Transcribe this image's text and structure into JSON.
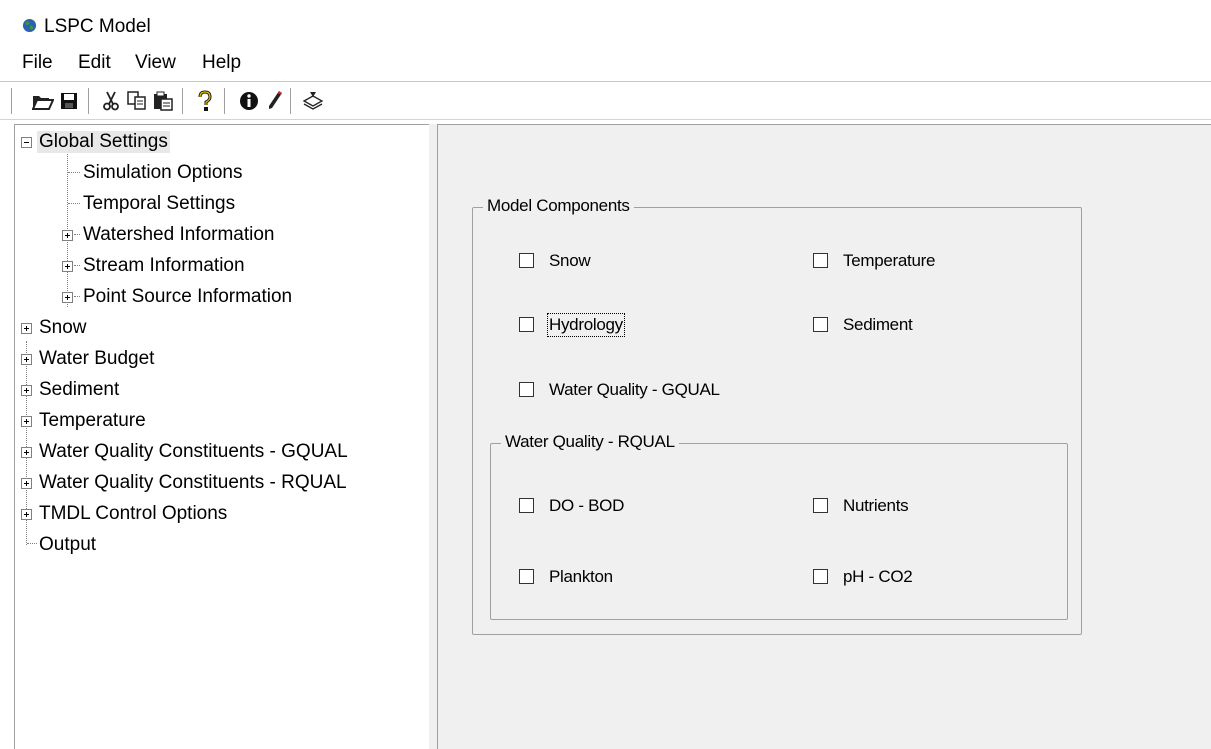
{
  "window": {
    "title": "LSPC Model"
  },
  "menu": [
    "File",
    "Edit",
    "View",
    "Help"
  ],
  "toolbar": {
    "buttons": [
      "open-icon",
      "save-icon",
      "cut-icon",
      "copy-icon",
      "paste-icon",
      "help-icon",
      "info-icon",
      "edit-pencil-icon",
      "run-model-icon"
    ]
  },
  "tree": {
    "items": [
      {
        "label": "Global Settings",
        "expanded": true,
        "selected": true
      },
      {
        "label": "Simulation Options"
      },
      {
        "label": "Temporal Settings"
      },
      {
        "label": "Watershed Information",
        "expanded": false
      },
      {
        "label": "Stream Information",
        "expanded": false
      },
      {
        "label": "Point Source Information",
        "expanded": false
      },
      {
        "label": "Snow",
        "expanded": false
      },
      {
        "label": "Water Budget",
        "expanded": false
      },
      {
        "label": "Sediment",
        "expanded": false
      },
      {
        "label": "Temperature",
        "expanded": false
      },
      {
        "label": "Water Quality Constituents - GQUAL",
        "expanded": false
      },
      {
        "label": "Water Quality Constituents - RQUAL",
        "expanded": false
      },
      {
        "label": "TMDL Control Options",
        "expanded": false
      },
      {
        "label": "Output"
      }
    ]
  },
  "model_components": {
    "legend": "Model Components",
    "checks": {
      "snow": {
        "label": "Snow",
        "checked": false
      },
      "temperature": {
        "label": "Temperature",
        "checked": false
      },
      "hydrology": {
        "label": "Hydrology",
        "checked": false
      },
      "sediment": {
        "label": "Sediment",
        "checked": false
      },
      "gqual": {
        "label": "Water Quality - GQUAL",
        "checked": false
      }
    },
    "rqual": {
      "legend": "Water Quality - RQUAL",
      "checks": {
        "do_bod": {
          "label": "DO - BOD",
          "checked": false
        },
        "nutrients": {
          "label": "Nutrients",
          "checked": false
        },
        "plankton": {
          "label": "Plankton",
          "checked": false
        },
        "ph_co2": {
          "label": "pH - CO2",
          "checked": false
        }
      }
    }
  }
}
